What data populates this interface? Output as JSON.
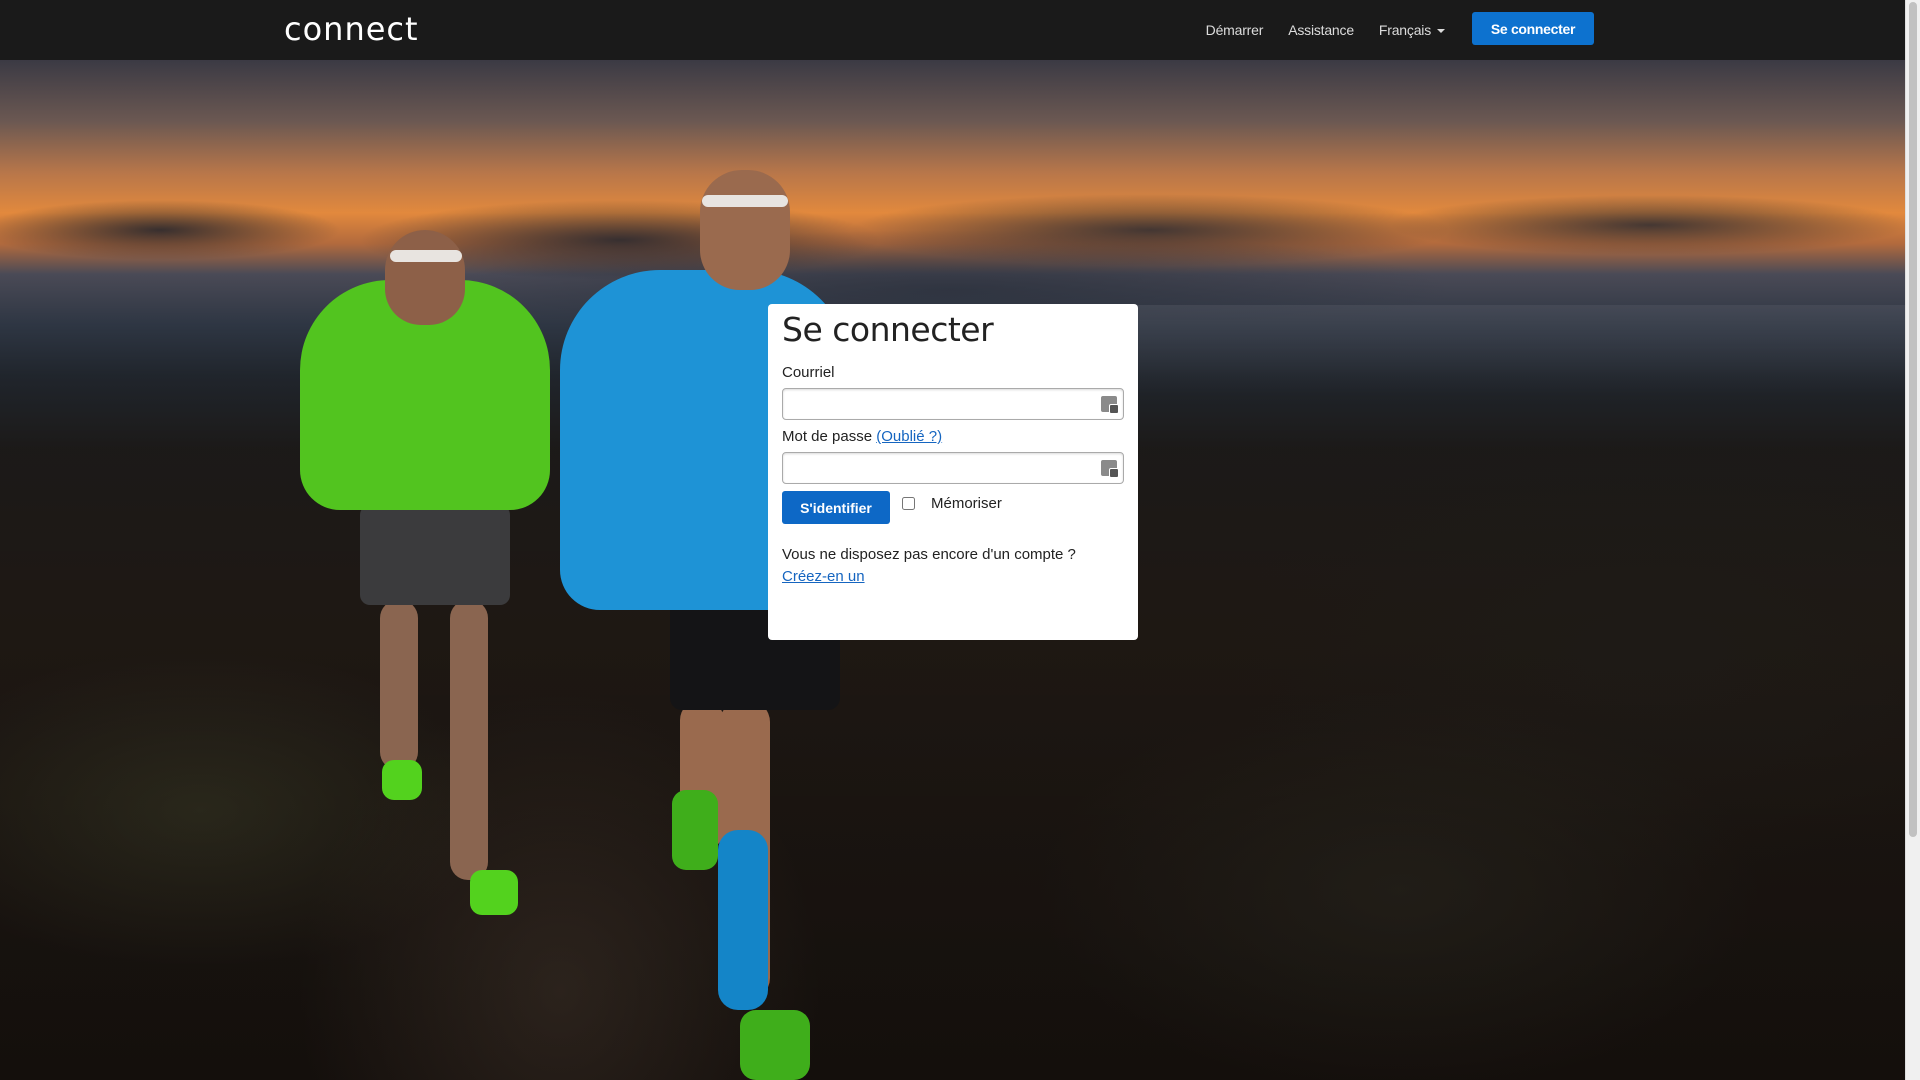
{
  "navbar": {
    "logo_text": "connect",
    "links": {
      "get_started": "Démarrer",
      "support": "Assistance",
      "language": "Français"
    },
    "signin_button": "Se connecter"
  },
  "login": {
    "title": "Se connecter",
    "email_label": "Courriel",
    "email_value": "",
    "password_label": "Mot de passe",
    "forgot_link": "(Oublié ?)",
    "password_value": "",
    "submit_label": "S'identifier",
    "remember_label": "Mémoriser",
    "remember_checked": false,
    "no_account_text": "Vous ne disposez pas encore d'un compte ?",
    "create_link": "Créez-en un"
  },
  "colors": {
    "navbar_bg": "#1a1a1a",
    "primary_button": "#0d72cf",
    "link": "#1565c0"
  },
  "icons": {
    "password_manager": "password-manager-icon",
    "language_caret": "caret-down-icon"
  }
}
